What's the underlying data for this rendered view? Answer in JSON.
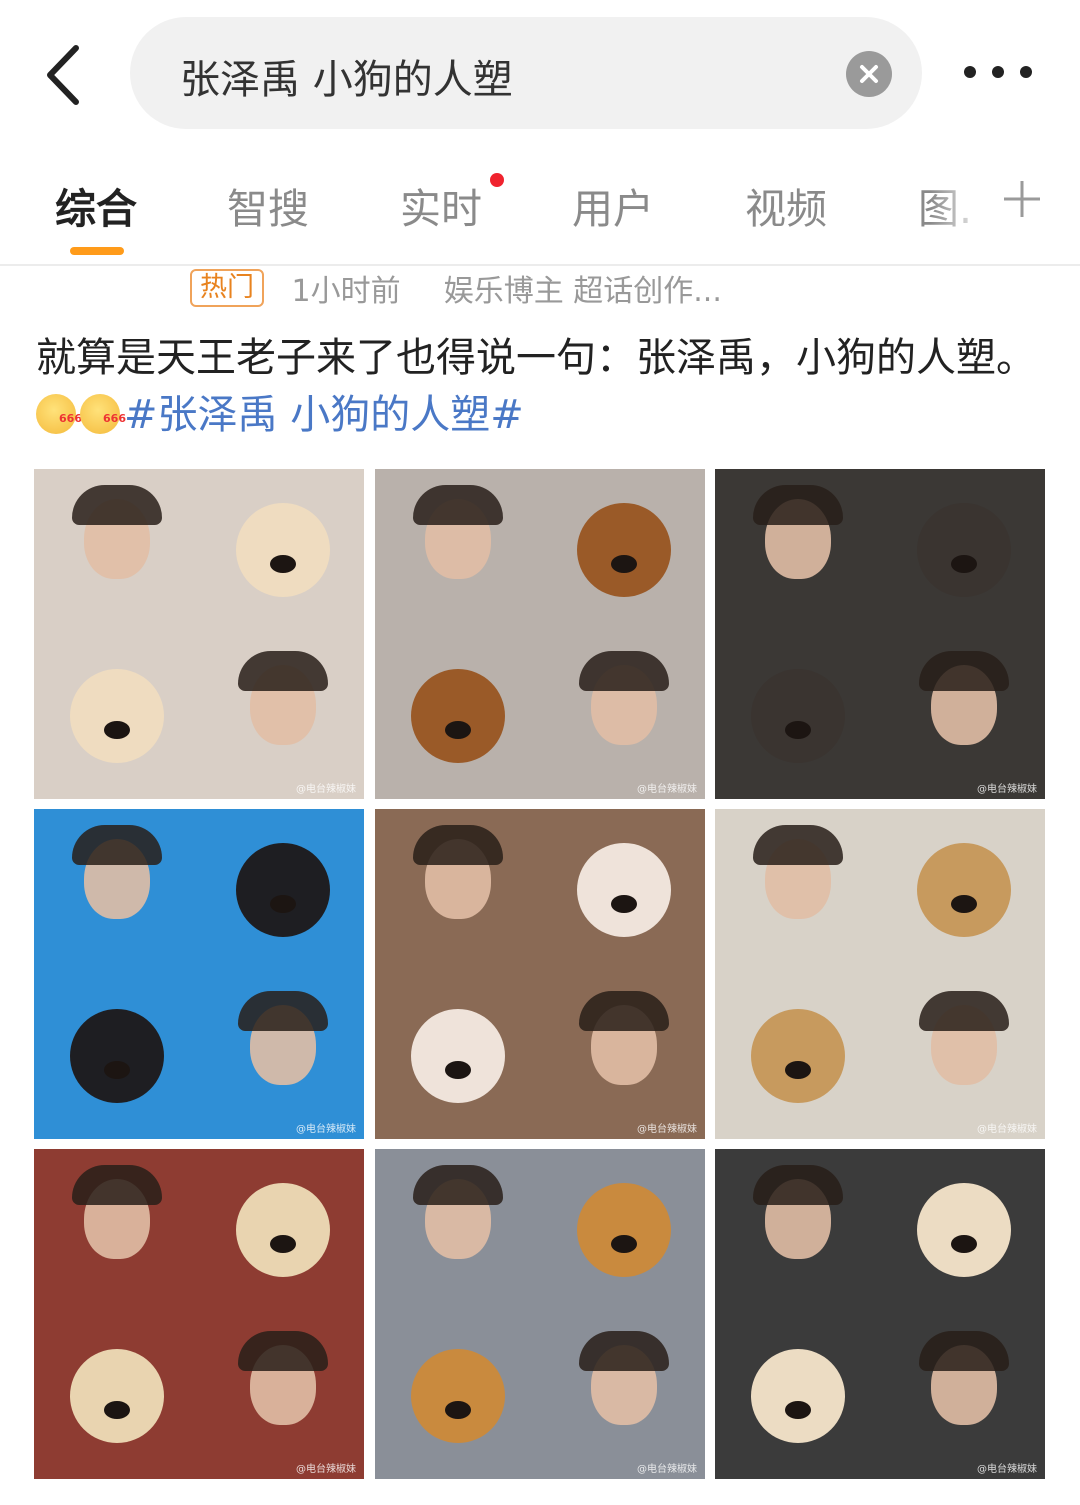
{
  "search": {
    "query": "张泽禹 小狗的人塑"
  },
  "tabs": [
    {
      "label": "综合"
    },
    {
      "label": "智搜"
    },
    {
      "label": "实时"
    },
    {
      "label": "用户"
    },
    {
      "label": "视频"
    },
    {
      "label": "图."
    }
  ],
  "post": {
    "badge": "热门",
    "time": "1小时前",
    "source": "娱乐博主 超话创作...",
    "text": "就算是天王老子来了也得说一句：张泽禹，小狗的人塑。",
    "hashtag": "#张泽禹 小狗的人塑#",
    "emoji_name": "666-emoji"
  },
  "images": [
    {
      "bg": "#d9cfc6",
      "dog_color": "#efdcc0"
    },
    {
      "bg": "#b9b1ab",
      "dog_color": "#9a5a28"
    },
    {
      "bg": "#3b3835",
      "dog_color": "#3a3430"
    },
    {
      "bg": "#2f8fd6",
      "dog_color": "#1e1e22"
    },
    {
      "bg": "#8a6a55",
      "dog_color": "#efe3da"
    },
    {
      "bg": "#d8d2c8",
      "dog_color": "#c79a5e"
    },
    {
      "bg": "#8e3c32",
      "dog_color": "#e9d4b0"
    },
    {
      "bg": "#8a8f98",
      "dog_color": "#c98a3e"
    },
    {
      "bg": "#3b3b3b",
      "dog_color": "#ecdcc3"
    }
  ],
  "watermark": "@电台辣椒妹",
  "colors": {
    "accent": "#ff9b1a",
    "hashtag": "#4a78c6",
    "live_dot": "#f0232e"
  }
}
